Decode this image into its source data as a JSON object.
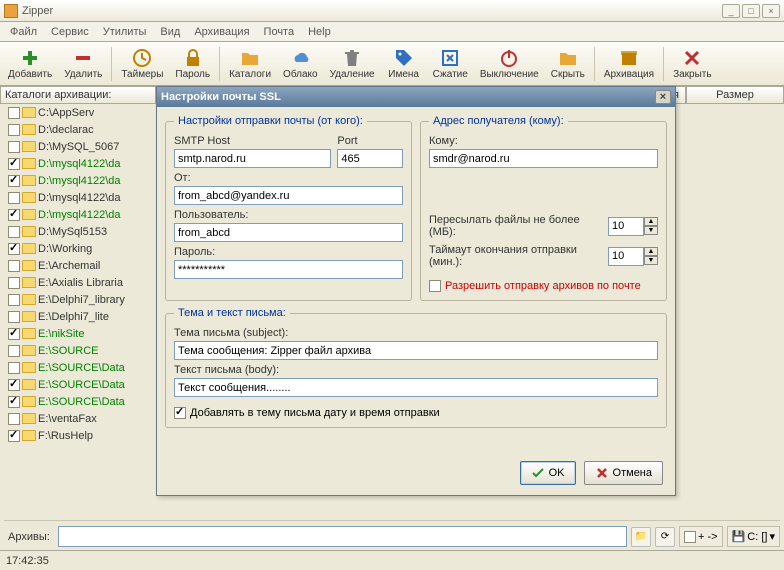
{
  "window": {
    "title": "Zipper"
  },
  "menu": [
    "Файл",
    "Сервис",
    "Утилиты",
    "Вид",
    "Архивация",
    "Почта",
    "Help"
  ],
  "toolbar": [
    {
      "label": "Добавить",
      "icon": "plus",
      "color": "#2a8f2a"
    },
    {
      "label": "Удалить",
      "icon": "minus",
      "color": "#c03030"
    },
    {
      "label": "Таймеры",
      "icon": "clock",
      "color": "#c08000"
    },
    {
      "label": "Пароль",
      "icon": "lock",
      "color": "#c08000"
    },
    {
      "label": "Каталоги",
      "icon": "folder",
      "color": "#e8a838"
    },
    {
      "label": "Облако",
      "icon": "cloud",
      "color": "#5090d0"
    },
    {
      "label": "Удаление",
      "icon": "trash",
      "color": "#808080"
    },
    {
      "label": "Имена",
      "icon": "tag",
      "color": "#3070c0"
    },
    {
      "label": "Сжатие",
      "icon": "compress",
      "color": "#3070c0"
    },
    {
      "label": "Выключение",
      "icon": "power",
      "color": "#c03030"
    },
    {
      "label": "Скрыть",
      "icon": "folder",
      "color": "#e8a838"
    },
    {
      "label": "Архивация",
      "icon": "archive",
      "color": "#c08000"
    },
    {
      "label": "Закрыть",
      "icon": "close",
      "color": "#c03030"
    }
  ],
  "columns": {
    "c1": "Каталоги архивации:",
    "c2": "я",
    "c3": "Размер"
  },
  "folders": [
    {
      "chk": false,
      "txt": "C:\\AppServ",
      "g": false
    },
    {
      "chk": false,
      "txt": "D:\\declarac",
      "g": false
    },
    {
      "chk": false,
      "txt": "D:\\MySQL_5067",
      "g": false
    },
    {
      "chk": true,
      "txt": "D:\\mysql4122\\da",
      "g": true
    },
    {
      "chk": true,
      "txt": "D:\\mysql4122\\da",
      "g": true
    },
    {
      "chk": false,
      "txt": "D:\\mysql4122\\da",
      "g": false
    },
    {
      "chk": true,
      "txt": "D:\\mysql4122\\da",
      "g": true
    },
    {
      "chk": false,
      "txt": "D:\\MySql5153",
      "g": false
    },
    {
      "chk": true,
      "txt": "D:\\Working",
      "g": false
    },
    {
      "chk": false,
      "txt": "E:\\Archemail",
      "g": false
    },
    {
      "chk": false,
      "txt": "E:\\Axialis Libraria",
      "g": false
    },
    {
      "chk": false,
      "txt": "E:\\Delphi7_library",
      "g": false
    },
    {
      "chk": false,
      "txt": "E:\\Delphi7_lite",
      "g": false
    },
    {
      "chk": true,
      "txt": "E:\\nikSite",
      "g": true
    },
    {
      "chk": false,
      "txt": "E:\\SOURCE",
      "g": true
    },
    {
      "chk": false,
      "txt": "E:\\SOURCE\\Data",
      "g": true
    },
    {
      "chk": true,
      "txt": "E:\\SOURCE\\Data",
      "g": true
    },
    {
      "chk": true,
      "txt": "E:\\SOURCE\\Data",
      "g": true
    },
    {
      "chk": false,
      "txt": "E:\\ventaFax",
      "g": false
    },
    {
      "chk": true,
      "txt": "F:\\RusHelp",
      "g": false
    }
  ],
  "dialog": {
    "title": "Настройки почты SSL",
    "fs1": {
      "legend": "Настройки отправки почты (от кого):",
      "host_lbl": "SMTP Host",
      "port_lbl": "Port",
      "host": "smtp.narod.ru",
      "port": "465",
      "from_lbl": "От:",
      "from": "from_abcd@yandex.ru",
      "user_lbl": "Пользователь:",
      "user": "from_abcd",
      "pass_lbl": "Пароль:",
      "pass": "***********"
    },
    "fs2": {
      "legend": "Адрес получателя (кому):",
      "to_lbl": "Кому:",
      "to": "smdr@narod.ru",
      "maxsize_lbl": "Пересылать файлы не более (МБ):",
      "maxsize": "10",
      "timeout_lbl": "Таймаут окончания отправки (мин.):",
      "timeout": "10",
      "allow_lbl": "Разрешить отправку архивов по почте"
    },
    "fs3": {
      "legend": "Тема и текст письма:",
      "subj_lbl": "Тема письма (subject):",
      "subj": "Тема сообщения: Zipper файл архива",
      "body_lbl": "Текст письма (body):",
      "body": "Текст сообщения........",
      "adddate_lbl": "Добавлять в тему письма дату и время отправки"
    },
    "ok": "OK",
    "cancel": "Отмена"
  },
  "bottom": {
    "label": "Архивы:",
    "net": "+ ->",
    "drive": "C: []"
  },
  "status": {
    "time": "17:42:35"
  }
}
